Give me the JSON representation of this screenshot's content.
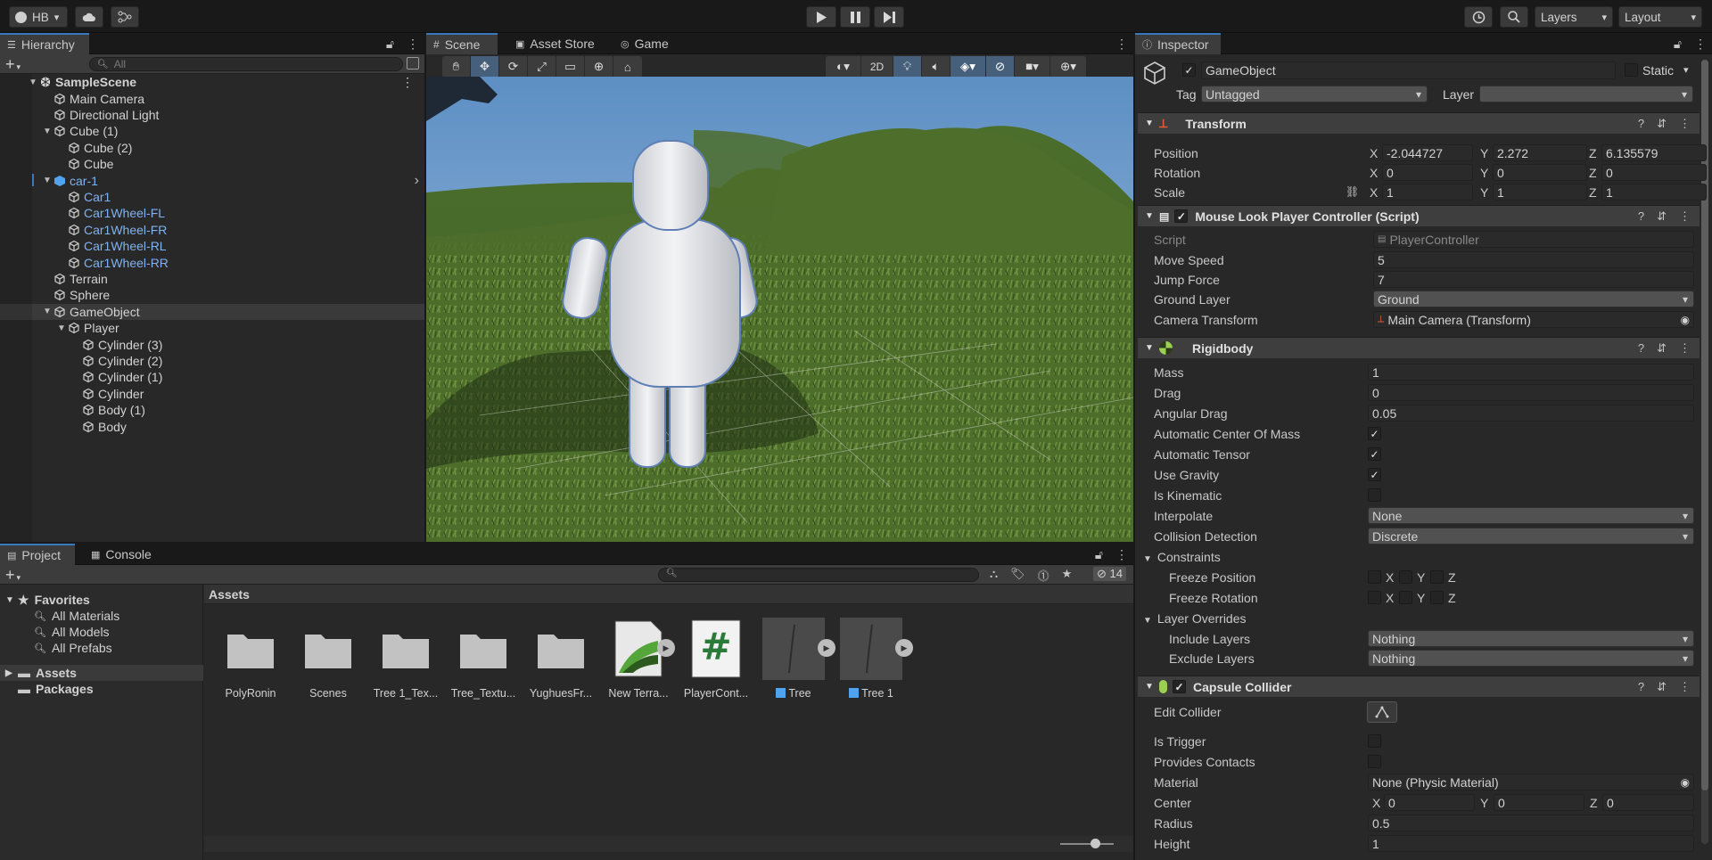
{
  "toolbar": {
    "account": "HB",
    "layers": "Layers",
    "layout": "Layout"
  },
  "hierarchy": {
    "tab": "Hierarchy",
    "search_placeholder": "All",
    "items": [
      {
        "label": "SampleScene",
        "depth": 0,
        "bold": true,
        "expanded": true
      },
      {
        "label": "Main Camera",
        "depth": 1
      },
      {
        "label": "Directional Light",
        "depth": 1
      },
      {
        "label": "Cube (1)",
        "depth": 1,
        "expanded": true
      },
      {
        "label": "Cube (2)",
        "depth": 2
      },
      {
        "label": "Cube",
        "depth": 2
      },
      {
        "label": "car-1",
        "depth": 1,
        "expanded": true,
        "blue": true
      },
      {
        "label": "Car1",
        "depth": 2,
        "blue": true
      },
      {
        "label": "Car1Wheel-FL",
        "depth": 2,
        "blue": true
      },
      {
        "label": "Car1Wheel-FR",
        "depth": 2,
        "blue": true
      },
      {
        "label": "Car1Wheel-RL",
        "depth": 2,
        "blue": true
      },
      {
        "label": "Car1Wheel-RR",
        "depth": 2,
        "blue": true
      },
      {
        "label": "Terrain",
        "depth": 1
      },
      {
        "label": "Sphere",
        "depth": 1
      },
      {
        "label": "GameObject",
        "depth": 1,
        "expanded": true,
        "selected": true
      },
      {
        "label": "Player",
        "depth": 2,
        "expanded": true
      },
      {
        "label": "Cylinder (3)",
        "depth": 3
      },
      {
        "label": "Cylinder (2)",
        "depth": 3
      },
      {
        "label": "Cylinder (1)",
        "depth": 3
      },
      {
        "label": "Cylinder",
        "depth": 3
      },
      {
        "label": "Body (1)",
        "depth": 3
      },
      {
        "label": "Body",
        "depth": 3
      }
    ]
  },
  "scene": {
    "tabs": [
      "Scene",
      "Asset Store",
      "Game"
    ],
    "mode_2d": "2D"
  },
  "project": {
    "tabs": [
      "Project",
      "Console"
    ],
    "hidden_count": "14",
    "favorites": "Favorites",
    "favorite_items": [
      "All Materials",
      "All Models",
      "All Prefabs"
    ],
    "assets_root": "Assets",
    "packages_root": "Packages",
    "breadcrumb": "Assets",
    "assets": [
      {
        "label": "PolyRonin",
        "kind": "folder"
      },
      {
        "label": "Scenes",
        "kind": "folder"
      },
      {
        "label": "Tree 1_Tex...",
        "kind": "folder"
      },
      {
        "label": "Tree_Textu...",
        "kind": "folder"
      },
      {
        "label": "YughuesFr...",
        "kind": "folder"
      },
      {
        "label": "New Terra...",
        "kind": "terrain"
      },
      {
        "label": "PlayerCont...",
        "kind": "script"
      },
      {
        "label": "Tree",
        "kind": "prefab"
      },
      {
        "label": "Tree 1",
        "kind": "prefab"
      }
    ]
  },
  "inspector": {
    "tab": "Inspector",
    "object_name": "GameObject",
    "static_label": "Static",
    "tag_label": "Tag",
    "tag_value": "Untagged",
    "layer_label": "Layer",
    "layer_value": "",
    "transform": {
      "title": "Transform",
      "position_label": "Position",
      "rotation_label": "Rotation",
      "scale_label": "Scale",
      "position": [
        "-2.044727",
        "2.272",
        "6.135579"
      ],
      "rotation": [
        "0",
        "0",
        "0"
      ],
      "scale": [
        "1",
        "1",
        "1"
      ]
    },
    "script": {
      "title": "Mouse Look Player Controller (Script)",
      "script_label": "Script",
      "script_value": "PlayerController",
      "move_speed_label": "Move Speed",
      "move_speed": "5",
      "jump_force_label": "Jump Force",
      "jump_force": "7",
      "ground_layer_label": "Ground Layer",
      "ground_layer": "Ground",
      "camera_transform_label": "Camera Transform",
      "camera_transform": "Main Camera (Transform)"
    },
    "rigidbody": {
      "title": "Rigidbody",
      "mass_label": "Mass",
      "mass": "1",
      "drag_label": "Drag",
      "drag": "0",
      "angular_drag_label": "Angular Drag",
      "angular_drag": "0.05",
      "auto_com_label": "Automatic Center Of Mass",
      "auto_tensor_label": "Automatic Tensor",
      "use_gravity_label": "Use Gravity",
      "is_kinematic_label": "Is Kinematic",
      "interpolate_label": "Interpolate",
      "interpolate": "None",
      "collision_label": "Collision Detection",
      "collision": "Discrete",
      "constraints_label": "Constraints",
      "freeze_pos_label": "Freeze Position",
      "freeze_rot_label": "Freeze Rotation",
      "layer_overrides_label": "Layer Overrides",
      "include_layers_label": "Include Layers",
      "include_layers": "Nothing",
      "exclude_layers_label": "Exclude Layers",
      "exclude_layers": "Nothing"
    },
    "capsule": {
      "title": "Capsule Collider",
      "edit_collider_label": "Edit Collider",
      "is_trigger_label": "Is Trigger",
      "provides_contacts_label": "Provides Contacts",
      "material_label": "Material",
      "material": "None (Physic Material)",
      "center_label": "Center",
      "center": [
        "0",
        "0",
        "0"
      ],
      "radius_label": "Radius",
      "radius": "0.5",
      "height_label": "Height",
      "height": "1"
    },
    "axes": [
      "X",
      "Y",
      "Z"
    ],
    "check": "✓"
  },
  "colors": {
    "selection_blue": "#3a79bb",
    "prefab_blue": "#7fb2f0",
    "panel_bg": "#282828",
    "sky": "#7aa5d2",
    "grass": "#4a6b2a"
  }
}
